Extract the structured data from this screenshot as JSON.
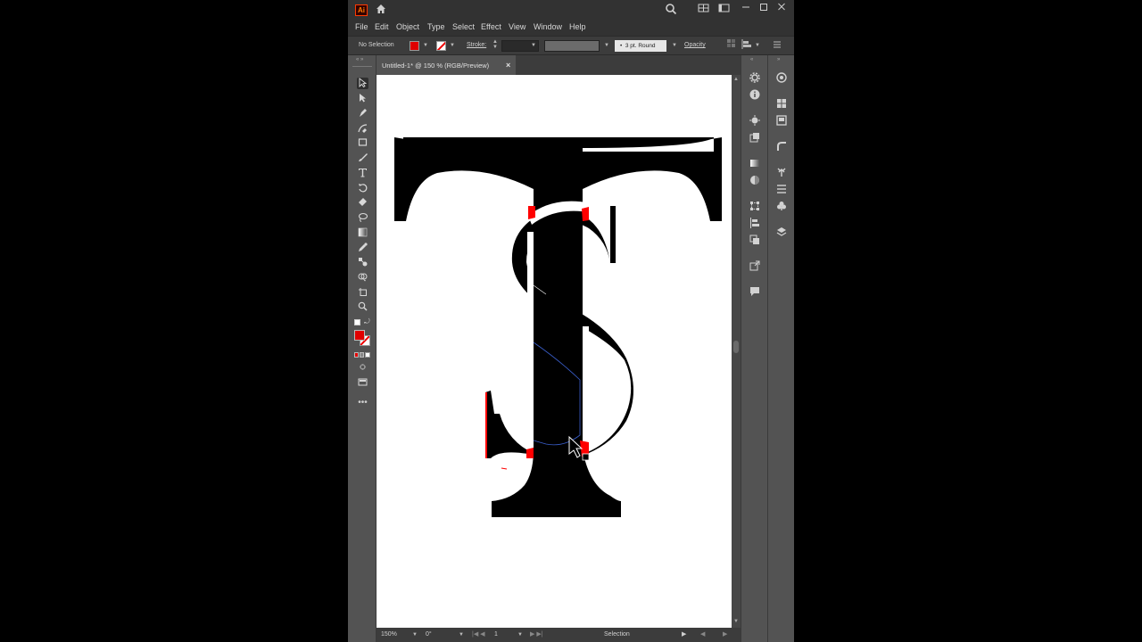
{
  "app": {
    "logo_text": "Ai",
    "icons": [
      "home-icon",
      "search-icon",
      "arrange-documents-icon",
      "workspace-icon",
      "minimize-icon",
      "maximize-icon",
      "close-icon"
    ]
  },
  "menu": [
    "File",
    "Edit",
    "Object",
    "Type",
    "Select",
    "Effect",
    "View",
    "Window",
    "Help"
  ],
  "control_bar": {
    "selection_label": "No Selection",
    "fill_color": "#e00000",
    "stroke_label": "Stroke:",
    "brush_label": "3 pt. Round",
    "opacity_label": "Opacity"
  },
  "document": {
    "tab_title": "Untitled-1* @ 150 % (RGB/Preview)",
    "close_glyph": "×"
  },
  "status_bar": {
    "zoom": "150%",
    "rotation": "0°",
    "artboard_number": "1",
    "tool_label": "Selection"
  },
  "tools": [
    "selection-tool",
    "direct-selection-tool",
    "pen-tool",
    "curvature-tool",
    "rectangle-tool",
    "paintbrush-tool",
    "type-tool",
    "rotate-tool",
    "eraser-tool",
    "lasso-tool",
    "gradient-tool",
    "eyedropper-tool",
    "blend-tool",
    "shape-builder-tool",
    "artboard-tool",
    "zoom-tool"
  ],
  "colors": {
    "accent_red": "#e00000",
    "artwork": "#000000",
    "path_highlight": "#ff0000",
    "selection_path": "#3a5fcd"
  }
}
